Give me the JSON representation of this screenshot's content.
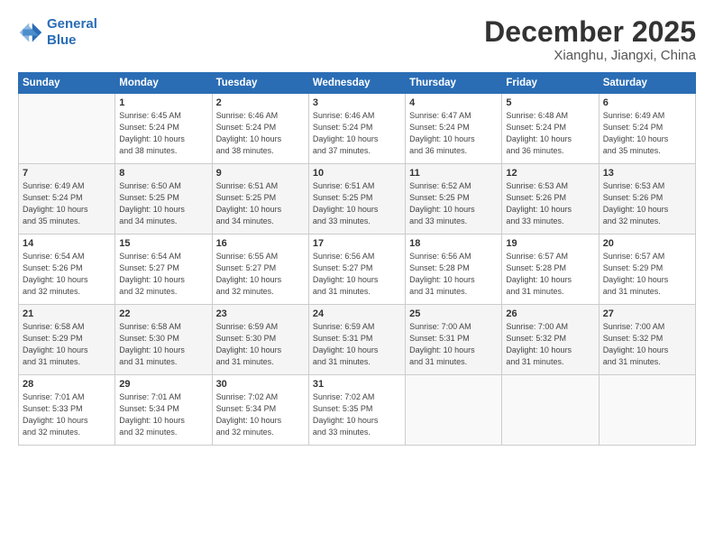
{
  "header": {
    "logo_line1": "General",
    "logo_line2": "Blue",
    "month": "December 2025",
    "location": "Xianghu, Jiangxi, China"
  },
  "weekdays": [
    "Sunday",
    "Monday",
    "Tuesday",
    "Wednesday",
    "Thursday",
    "Friday",
    "Saturday"
  ],
  "weeks": [
    [
      {
        "day": "",
        "info": ""
      },
      {
        "day": "1",
        "info": "Sunrise: 6:45 AM\nSunset: 5:24 PM\nDaylight: 10 hours\nand 38 minutes."
      },
      {
        "day": "2",
        "info": "Sunrise: 6:46 AM\nSunset: 5:24 PM\nDaylight: 10 hours\nand 38 minutes."
      },
      {
        "day": "3",
        "info": "Sunrise: 6:46 AM\nSunset: 5:24 PM\nDaylight: 10 hours\nand 37 minutes."
      },
      {
        "day": "4",
        "info": "Sunrise: 6:47 AM\nSunset: 5:24 PM\nDaylight: 10 hours\nand 36 minutes."
      },
      {
        "day": "5",
        "info": "Sunrise: 6:48 AM\nSunset: 5:24 PM\nDaylight: 10 hours\nand 36 minutes."
      },
      {
        "day": "6",
        "info": "Sunrise: 6:49 AM\nSunset: 5:24 PM\nDaylight: 10 hours\nand 35 minutes."
      }
    ],
    [
      {
        "day": "7",
        "info": "Sunrise: 6:49 AM\nSunset: 5:24 PM\nDaylight: 10 hours\nand 35 minutes."
      },
      {
        "day": "8",
        "info": "Sunrise: 6:50 AM\nSunset: 5:25 PM\nDaylight: 10 hours\nand 34 minutes."
      },
      {
        "day": "9",
        "info": "Sunrise: 6:51 AM\nSunset: 5:25 PM\nDaylight: 10 hours\nand 34 minutes."
      },
      {
        "day": "10",
        "info": "Sunrise: 6:51 AM\nSunset: 5:25 PM\nDaylight: 10 hours\nand 33 minutes."
      },
      {
        "day": "11",
        "info": "Sunrise: 6:52 AM\nSunset: 5:25 PM\nDaylight: 10 hours\nand 33 minutes."
      },
      {
        "day": "12",
        "info": "Sunrise: 6:53 AM\nSunset: 5:26 PM\nDaylight: 10 hours\nand 33 minutes."
      },
      {
        "day": "13",
        "info": "Sunrise: 6:53 AM\nSunset: 5:26 PM\nDaylight: 10 hours\nand 32 minutes."
      }
    ],
    [
      {
        "day": "14",
        "info": "Sunrise: 6:54 AM\nSunset: 5:26 PM\nDaylight: 10 hours\nand 32 minutes."
      },
      {
        "day": "15",
        "info": "Sunrise: 6:54 AM\nSunset: 5:27 PM\nDaylight: 10 hours\nand 32 minutes."
      },
      {
        "day": "16",
        "info": "Sunrise: 6:55 AM\nSunset: 5:27 PM\nDaylight: 10 hours\nand 32 minutes."
      },
      {
        "day": "17",
        "info": "Sunrise: 6:56 AM\nSunset: 5:27 PM\nDaylight: 10 hours\nand 31 minutes."
      },
      {
        "day": "18",
        "info": "Sunrise: 6:56 AM\nSunset: 5:28 PM\nDaylight: 10 hours\nand 31 minutes."
      },
      {
        "day": "19",
        "info": "Sunrise: 6:57 AM\nSunset: 5:28 PM\nDaylight: 10 hours\nand 31 minutes."
      },
      {
        "day": "20",
        "info": "Sunrise: 6:57 AM\nSunset: 5:29 PM\nDaylight: 10 hours\nand 31 minutes."
      }
    ],
    [
      {
        "day": "21",
        "info": "Sunrise: 6:58 AM\nSunset: 5:29 PM\nDaylight: 10 hours\nand 31 minutes."
      },
      {
        "day": "22",
        "info": "Sunrise: 6:58 AM\nSunset: 5:30 PM\nDaylight: 10 hours\nand 31 minutes."
      },
      {
        "day": "23",
        "info": "Sunrise: 6:59 AM\nSunset: 5:30 PM\nDaylight: 10 hours\nand 31 minutes."
      },
      {
        "day": "24",
        "info": "Sunrise: 6:59 AM\nSunset: 5:31 PM\nDaylight: 10 hours\nand 31 minutes."
      },
      {
        "day": "25",
        "info": "Sunrise: 7:00 AM\nSunset: 5:31 PM\nDaylight: 10 hours\nand 31 minutes."
      },
      {
        "day": "26",
        "info": "Sunrise: 7:00 AM\nSunset: 5:32 PM\nDaylight: 10 hours\nand 31 minutes."
      },
      {
        "day": "27",
        "info": "Sunrise: 7:00 AM\nSunset: 5:32 PM\nDaylight: 10 hours\nand 31 minutes."
      }
    ],
    [
      {
        "day": "28",
        "info": "Sunrise: 7:01 AM\nSunset: 5:33 PM\nDaylight: 10 hours\nand 32 minutes."
      },
      {
        "day": "29",
        "info": "Sunrise: 7:01 AM\nSunset: 5:34 PM\nDaylight: 10 hours\nand 32 minutes."
      },
      {
        "day": "30",
        "info": "Sunrise: 7:02 AM\nSunset: 5:34 PM\nDaylight: 10 hours\nand 32 minutes."
      },
      {
        "day": "31",
        "info": "Sunrise: 7:02 AM\nSunset: 5:35 PM\nDaylight: 10 hours\nand 33 minutes."
      },
      {
        "day": "",
        "info": ""
      },
      {
        "day": "",
        "info": ""
      },
      {
        "day": "",
        "info": ""
      }
    ]
  ]
}
